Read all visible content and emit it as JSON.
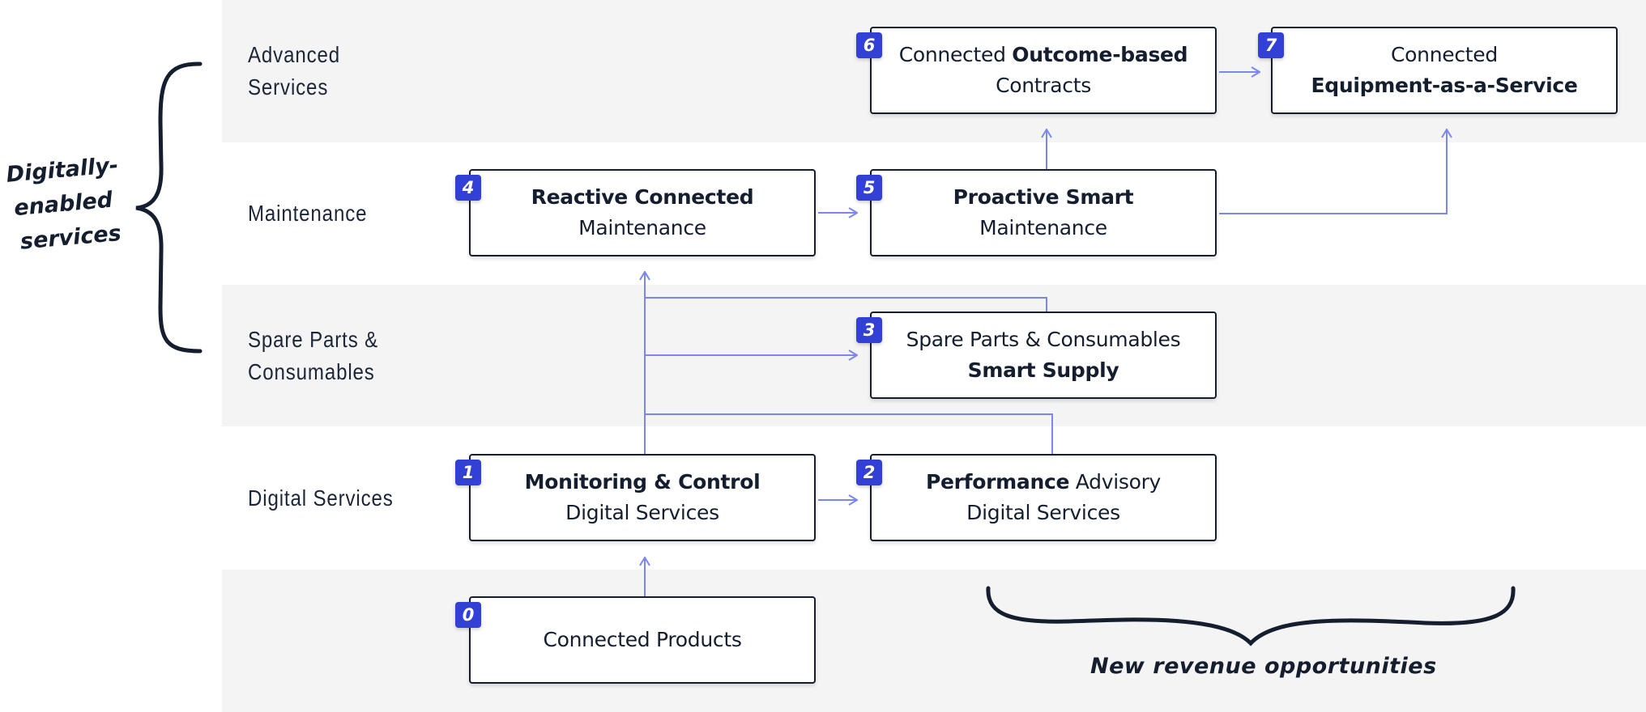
{
  "colors": {
    "band_gray": "#f4f4f4",
    "badge_blue": "#3340d6",
    "connector": "#7b87ee",
    "ink": "#141e2e"
  },
  "rows": [
    {
      "label_lines": [
        "Advanced",
        "Services"
      ]
    },
    {
      "label_lines": [
        "Maintenance"
      ]
    },
    {
      "label_lines": [
        "Spare Parts &",
        "Consumables"
      ]
    },
    {
      "label_lines": [
        "Digital Services"
      ]
    },
    {
      "label_lines": []
    }
  ],
  "nodes": [
    {
      "number": "0",
      "lines": [
        [
          {
            "text": "Connected Products",
            "bold": false
          }
        ]
      ]
    },
    {
      "number": "1",
      "lines": [
        [
          {
            "text": "Monitoring & Control",
            "bold": true
          }
        ],
        [
          {
            "text": "Digital Services",
            "bold": false
          }
        ]
      ]
    },
    {
      "number": "2",
      "lines": [
        [
          {
            "text": "Performance",
            "bold": true
          },
          {
            "text": " Advisory",
            "bold": false
          }
        ],
        [
          {
            "text": "Digital Services",
            "bold": false
          }
        ]
      ]
    },
    {
      "number": "3",
      "lines": [
        [
          {
            "text": "Spare Parts & Consumables",
            "bold": false
          }
        ],
        [
          {
            "text": "Smart Supply",
            "bold": true
          }
        ]
      ]
    },
    {
      "number": "4",
      "lines": [
        [
          {
            "text": "Reactive Connected",
            "bold": true
          }
        ],
        [
          {
            "text": "Maintenance",
            "bold": false
          }
        ]
      ]
    },
    {
      "number": "5",
      "lines": [
        [
          {
            "text": "Proactive Smart",
            "bold": true
          }
        ],
        [
          {
            "text": "Maintenance",
            "bold": false
          }
        ]
      ]
    },
    {
      "number": "6",
      "lines": [
        [
          {
            "text": "Connected ",
            "bold": false
          },
          {
            "text": "Outcome-based",
            "bold": true
          }
        ],
        [
          {
            "text": "Contracts",
            "bold": false
          }
        ]
      ]
    },
    {
      "number": "7",
      "lines": [
        [
          {
            "text": "Connected",
            "bold": false
          }
        ],
        [
          {
            "text": "Equipment-as-a-Service",
            "bold": true
          }
        ]
      ]
    }
  ],
  "edges": [
    {
      "from": "0",
      "to": "1"
    },
    {
      "from": "1",
      "to": "2"
    },
    {
      "from": "1",
      "to": "3"
    },
    {
      "from": "1",
      "to": "4"
    },
    {
      "from": "2",
      "to": "4"
    },
    {
      "from": "3",
      "to": "4"
    },
    {
      "from": "4",
      "to": "5"
    },
    {
      "from": "5",
      "to": "6"
    },
    {
      "from": "5",
      "to": "7"
    },
    {
      "from": "6",
      "to": "7"
    }
  ],
  "annotations": {
    "digitally_enabled": [
      "Digitally-",
      "enabled",
      "services"
    ],
    "new_revenue": "New revenue opportunities"
  }
}
